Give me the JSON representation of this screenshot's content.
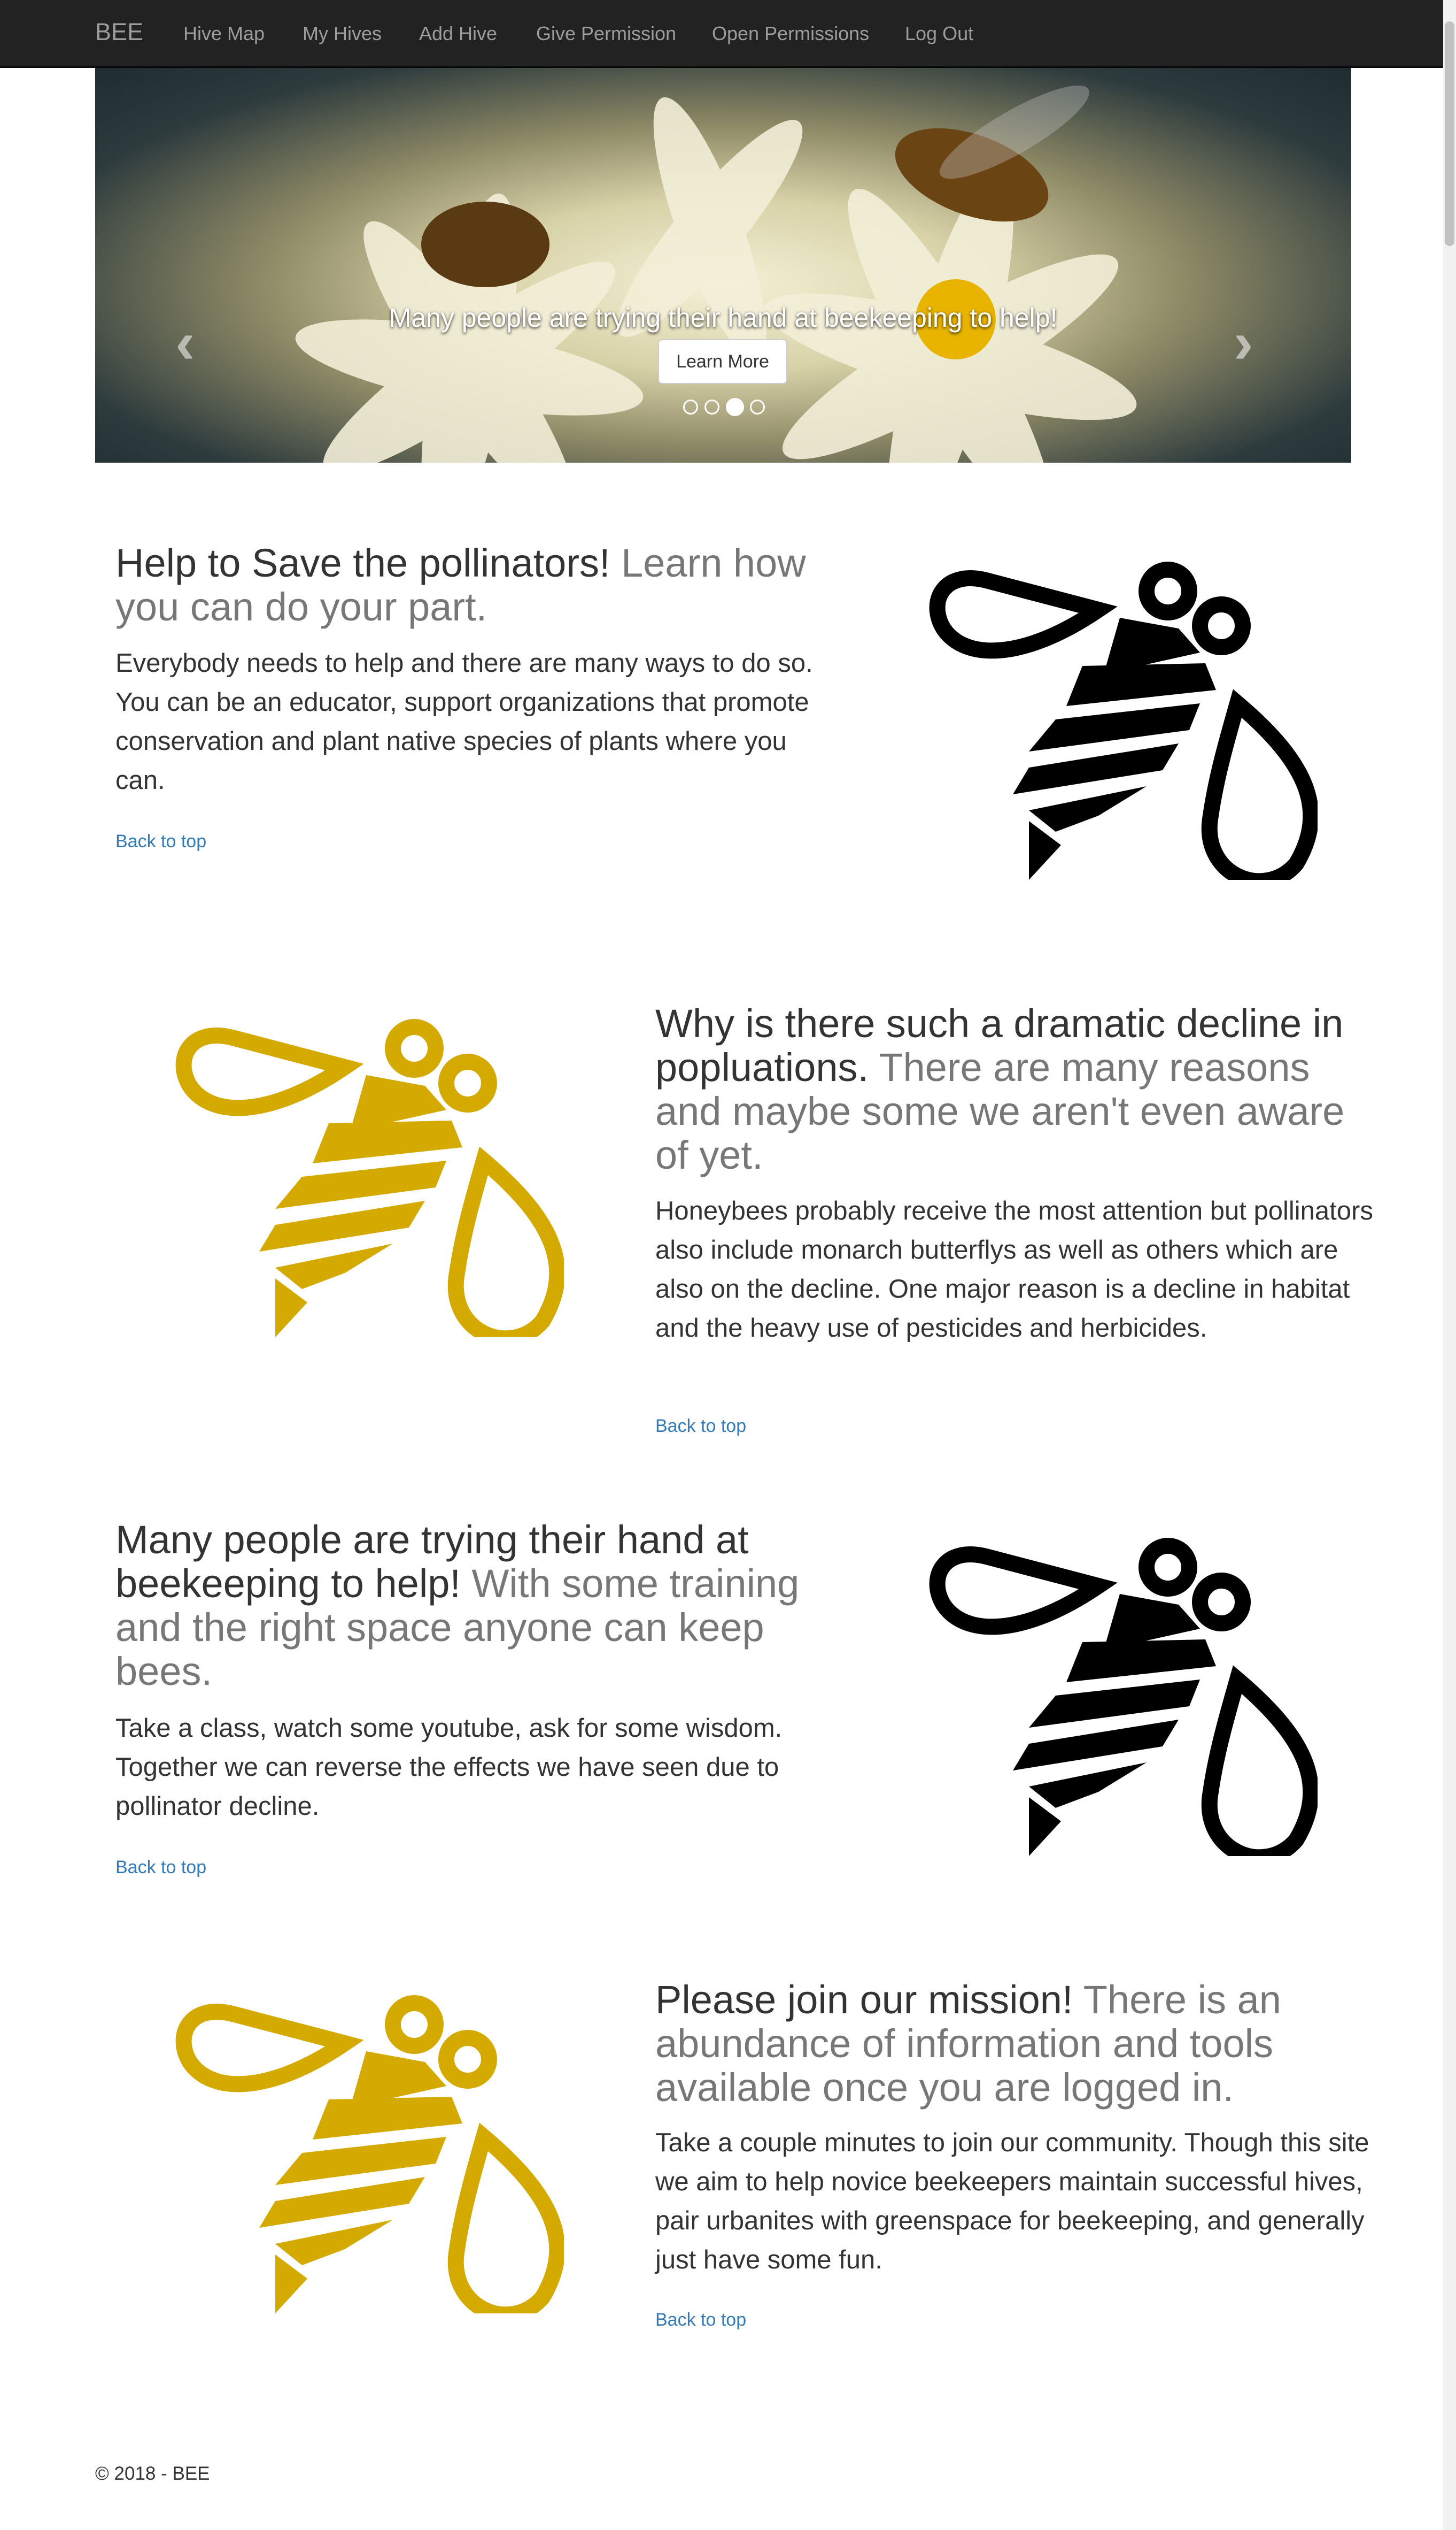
{
  "navbar": {
    "brand": "BEE",
    "items": [
      "Hive Map",
      "My Hives",
      "Add Hive",
      "Give Permission",
      "Open Permissions",
      "Log Out"
    ]
  },
  "carousel": {
    "caption": "Many people are trying their hand at beekeeping to help!",
    "button_label": "Learn More",
    "slide_count": 4,
    "active_slide": 3,
    "prev_icon": "chevron-left-icon",
    "next_icon": "chevron-right-icon"
  },
  "features": [
    {
      "heading": "Help to Save the pollinators!",
      "subheading": "Learn how you can do your part.",
      "body": "Everybody needs to help and there are many ways to do so. You can be an educator, support organizations that promote conservation and plant native species of plants where you can.",
      "link": "Back to top",
      "image": "bee-icon",
      "image_color": "#000000"
    },
    {
      "heading": "Why is there such a dramatic decline in popluations.",
      "subheading": "There are many reasons and maybe some we aren't even aware of yet.",
      "body": "Honeybees probably receive the most attention but pollinators also include monarch butterflys as well as others which are also on the decline. One major reason is a decline in habitat and the heavy use of pesticides and herbicides.",
      "link": "Back to top",
      "image": "bee-icon",
      "image_color": "#d4aa00"
    },
    {
      "heading": "Many people are trying their hand at beekeeping to help!",
      "subheading": "With some training and the right space anyone can keep bees.",
      "body": "Take a class, watch some youtube, ask for some wisdom. Together we can reverse the effects we have seen due to pollinator decline.",
      "link": "Back to top",
      "image": "bee-icon",
      "image_color": "#000000"
    },
    {
      "heading": "Please join our mission!",
      "subheading": "There is an abundance of information and tools available once you are logged in.",
      "body": "Take a couple minutes to join our community. Though this site we aim to help novice beekeepers maintain successful hives, pair urbanites with greenspace for beekeeping, and generally just have some fun.",
      "link": "Back to top",
      "image": "bee-icon",
      "image_color": "#d4aa00"
    }
  ],
  "footer": {
    "text": "© 2018 - BEE"
  },
  "colors": {
    "navbar_bg": "#222222",
    "link": "#337ab7",
    "muted": "#777777",
    "bee_gold": "#d4aa00"
  }
}
